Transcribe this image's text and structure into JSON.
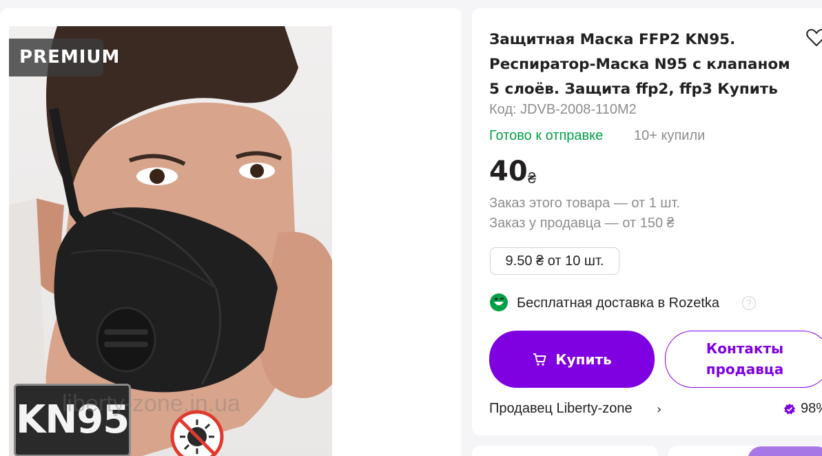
{
  "gallery": {
    "premium_badge": "PREMIUM",
    "kn95_label": "KN95",
    "watermark": "liberty-zone.in.ua"
  },
  "product": {
    "title": "Защитная Маска FFP2 KN95. Респиратор-Маска N95 с клапаном 5 слоёв. Защита ffp2, ffp3 Купить",
    "code": "Код: JDVB-2008-110M2",
    "status": "Готово к отправке",
    "bought": "10+ купили",
    "price": "40",
    "currency": "₴",
    "order_min_item": "Заказ этого товара — от 1 шт.",
    "order_min_seller": "Заказ у продавца — от 150 ₴",
    "wholesale_tier": "9.50 ₴ от 10 шт.",
    "delivery": "Бесплатная доставка в Rozetka",
    "help_glyph": "?"
  },
  "actions": {
    "buy_label": "Купить",
    "contact_label_line1": "Контакты",
    "contact_label_line2": "продавца"
  },
  "seller": {
    "label": "Продавец Liberty-zone",
    "chevron": "›",
    "rating": "98%"
  },
  "colors": {
    "accent": "#7f00e0",
    "status_green": "#00a046",
    "muted_text": "#8c8c8c"
  },
  "icons": [
    "heart-icon",
    "cart-icon",
    "smile-delivery-icon",
    "help-icon",
    "chevron-right-icon",
    "verified-badge-icon",
    "no-virus-icon"
  ]
}
